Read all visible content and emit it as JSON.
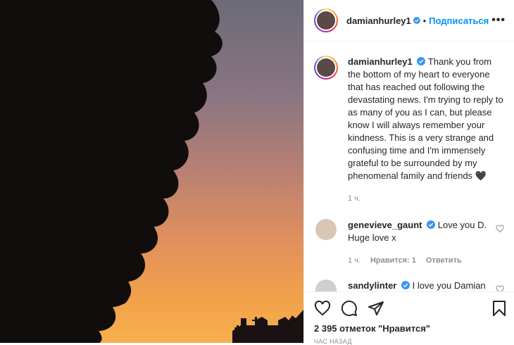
{
  "header": {
    "username": "damianhurley1",
    "separator": "•",
    "follow_label": "Подписаться",
    "more_label": "•••"
  },
  "caption": {
    "username": "damianhurley1",
    "text": "Thank you from the bottom of my heart to everyone that has reached out following the devastating news. I'm trying to reply to as many of you as I can, but please know I will always remember your kindness. This is a very strange and confusing time and I'm immensely grateful to be surrounded by my phenomenal family and friends 🖤",
    "time": "1 ч."
  },
  "comments": [
    {
      "username": "genevieve_gaunt",
      "text": "Love you D. Huge love x",
      "time": "1 ч.",
      "likes": "Нравится: 1",
      "reply_label": "Ответить"
    },
    {
      "username": "sandylinter",
      "text": "I love you Damian",
      "emoji": "💋"
    }
  ],
  "footer": {
    "likes": "2 395 отметок \"Нравится\"",
    "timestamp": "ЧАС НАЗАД"
  },
  "icons": {
    "like": "heart-icon",
    "comment": "comment-icon",
    "share": "share-icon",
    "save": "bookmark-icon",
    "verified": "verified-badge-icon"
  },
  "colors": {
    "accent": "#0095f6",
    "text": "#262626",
    "muted": "#8e8e8e"
  }
}
